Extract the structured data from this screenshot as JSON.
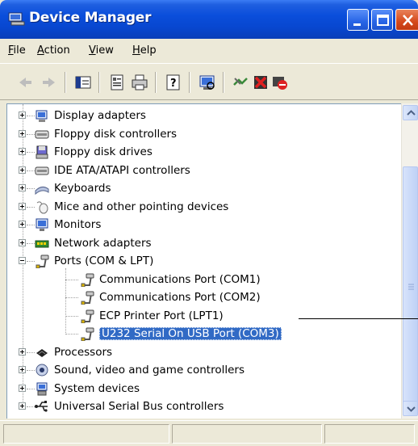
{
  "window": {
    "title": "Device Manager",
    "title_color": "#0a4edb"
  },
  "menu": [
    {
      "label": "File"
    },
    {
      "label": "Action"
    },
    {
      "label": "View"
    },
    {
      "label": "Help"
    }
  ],
  "toolbar": {
    "buttons": [
      "back-icon",
      "forward-icon",
      "console-tree-icon",
      "properties-icon",
      "print-icon",
      "help-icon",
      "scan-hardware-icon",
      "update-driver-icon",
      "uninstall-icon",
      "disable-icon"
    ]
  },
  "tree": {
    "items": [
      {
        "label": "Display adapters",
        "icon": "display-adapter-icon"
      },
      {
        "label": "Floppy disk controllers",
        "icon": "controller-icon"
      },
      {
        "label": "Floppy disk drives",
        "icon": "floppy-drive-icon"
      },
      {
        "label": "IDE ATA/ATAPI controllers",
        "icon": "controller-icon"
      },
      {
        "label": "Keyboards",
        "icon": "keyboard-icon"
      },
      {
        "label": "Mice and other pointing devices",
        "icon": "mouse-icon"
      },
      {
        "label": "Monitors",
        "icon": "monitor-icon"
      },
      {
        "label": "Network adapters",
        "icon": "network-adapter-icon"
      },
      {
        "label": "Ports (COM & LPT)",
        "icon": "port-icon",
        "expanded": true
      },
      {
        "label": "Communications Port (COM1)",
        "icon": "port-icon",
        "child": true
      },
      {
        "label": "Communications Port (COM2)",
        "icon": "port-icon",
        "child": true
      },
      {
        "label": "ECP Printer Port (LPT1)",
        "icon": "port-icon",
        "child": true
      },
      {
        "label": "U232 Serial On USB Port (COM3)",
        "icon": "port-icon",
        "child": true,
        "selected": true
      },
      {
        "label": "Processors",
        "icon": "processor-icon"
      },
      {
        "label": "Sound, video and game controllers",
        "icon": "sound-icon"
      },
      {
        "label": "System devices",
        "icon": "system-icon"
      },
      {
        "label": "Universal Serial Bus controllers",
        "icon": "usb-icon"
      }
    ]
  },
  "colors": {
    "selection": "#316ac5",
    "chrome": "#ece9d8"
  }
}
